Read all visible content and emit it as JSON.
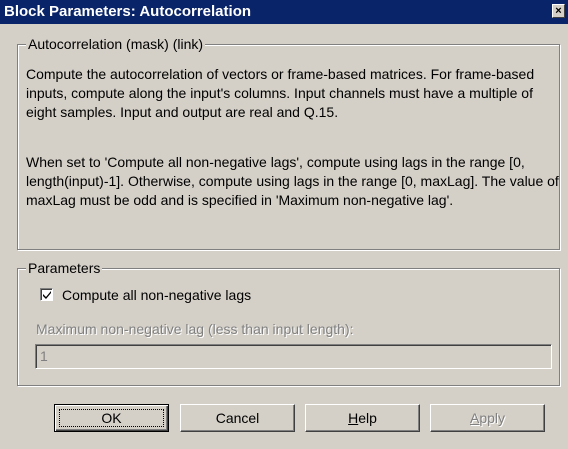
{
  "window": {
    "title": "Block Parameters: Autocorrelation",
    "close_glyph": "×"
  },
  "mask_group": {
    "legend": "Autocorrelation (mask) (link)",
    "paragraph1": "Compute the autocorrelation of vectors or frame-based matrices. For frame-based inputs, compute along the input's columns. Input channels must have a multiple of eight samples. Input and output are real and Q.15.",
    "paragraph2": "When set to 'Compute all non-negative lags', compute using lags in the range [0, length(input)-1]. Otherwise, compute using lags in the range [0, maxLag]. The value of maxLag must be odd and is specified in 'Maximum non-negative lag'."
  },
  "parameters": {
    "legend": "Parameters",
    "compute_all_lags": {
      "label": "Compute all non-negative lags",
      "checked": true
    },
    "max_lag": {
      "label": "Maximum non-negative lag (less than input length):",
      "value": "1",
      "enabled": false
    }
  },
  "buttons": {
    "ok": "OK",
    "cancel": "Cancel",
    "help_prefix": "H",
    "help_rest": "elp",
    "apply_prefix": "A",
    "apply_rest": "pply"
  }
}
